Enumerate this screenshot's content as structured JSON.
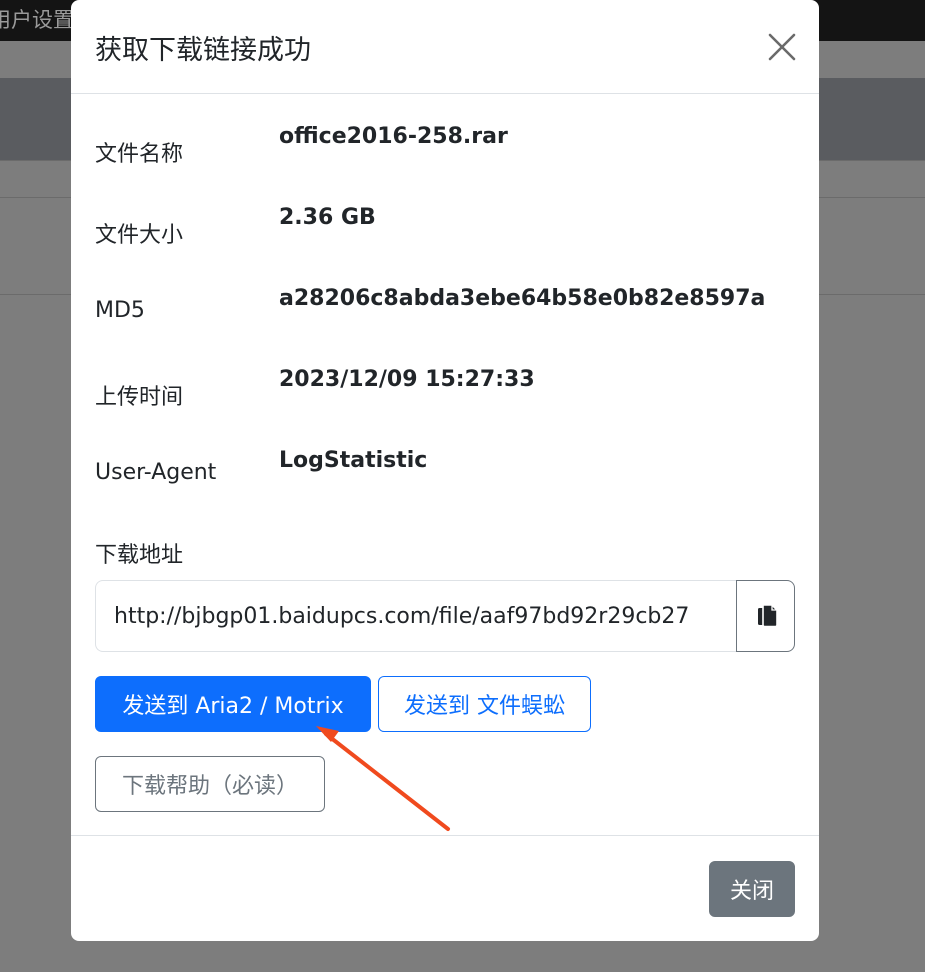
{
  "background": {
    "topbar_text": "用户设置"
  },
  "modal": {
    "title": "获取下载链接成功",
    "fields": [
      {
        "label": "文件名称",
        "value": "office2016-258.rar"
      },
      {
        "label": "文件大小",
        "value": "2.36 GB"
      },
      {
        "label": "MD5",
        "value": "a28206c8abda3ebe64b58e0b82e8597a"
      },
      {
        "label": "上传时间",
        "value": "2023/12/09 15:27:33"
      },
      {
        "label": "User-Agent",
        "value": "LogStatistic"
      }
    ],
    "download_url": {
      "label": "下载地址",
      "value": "http://bjbgp01.baidupcs.com/file/aaf97bd92r29cb27"
    },
    "buttons": {
      "send_aria2": "发送到 Aria2 / Motrix",
      "send_file_centipede": "发送到 文件蜈蚣",
      "download_help": "下载帮助（必读）",
      "close": "关闭"
    }
  },
  "icons": {
    "close": "close-icon",
    "copy": "copy-icon"
  },
  "colors": {
    "primary": "#0d6efd",
    "secondary": "#6c757d",
    "annotation_arrow": "#f04a1e"
  }
}
